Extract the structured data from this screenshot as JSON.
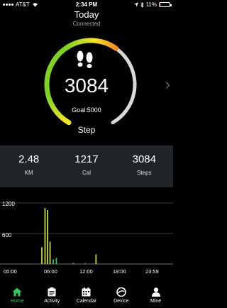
{
  "status_bar": {
    "carrier": "AT&T",
    "time": "2:34 PM",
    "battery": "11%",
    "battery_level": 0.11
  },
  "header": {
    "title": "Today",
    "subtitle": "Connected"
  },
  "progress": {
    "steps": "3084",
    "goal_text": "Goal:5000",
    "label": "Step",
    "fraction": 0.617
  },
  "stats": [
    {
      "value": "2.48",
      "unit": "KM"
    },
    {
      "value": "1217",
      "unit": "Cal"
    },
    {
      "value": "3084",
      "unit": "Steps"
    }
  ],
  "chart_data": {
    "type": "bar",
    "y_ticks": [
      "1200",
      "600"
    ],
    "x_ticks": [
      "00:00",
      "06:00",
      "12:00",
      "18:00",
      "23:59"
    ],
    "ylim": [
      0,
      1200
    ],
    "bars": [
      {
        "t": 5.3,
        "value": 330,
        "color": "#c6d93a"
      },
      {
        "t": 5.8,
        "value": 1100,
        "color": "#c6d93a"
      },
      {
        "t": 6.2,
        "value": 1060,
        "color": "#c6d93a"
      },
      {
        "t": 6.6,
        "value": 440,
        "color": "#c6d93a"
      },
      {
        "t": 7.1,
        "value": 90,
        "color": "#34c759"
      },
      {
        "t": 7.6,
        "value": 120,
        "color": "#34c759"
      },
      {
        "t": 10.3,
        "value": 20,
        "color": "#888"
      },
      {
        "t": 12.2,
        "value": 15,
        "color": "#888"
      },
      {
        "t": 13.9,
        "value": 190,
        "color": "#c6d93a"
      }
    ]
  },
  "tabs": [
    {
      "label": "Home",
      "icon": "home-icon",
      "active": true
    },
    {
      "label": "Activity",
      "icon": "activity-icon",
      "active": false
    },
    {
      "label": "Calendar",
      "icon": "calendar-icon",
      "active": false
    },
    {
      "label": "Device",
      "icon": "watch-icon",
      "active": false
    },
    {
      "label": "Mine",
      "icon": "user-icon",
      "active": false
    }
  ],
  "colors": {
    "accent": "#34c759",
    "ring_start": "#7ed321",
    "ring_mid": "#f5e623",
    "ring_end": "#ff8c1a",
    "ring_track": "#d9d9d9"
  }
}
